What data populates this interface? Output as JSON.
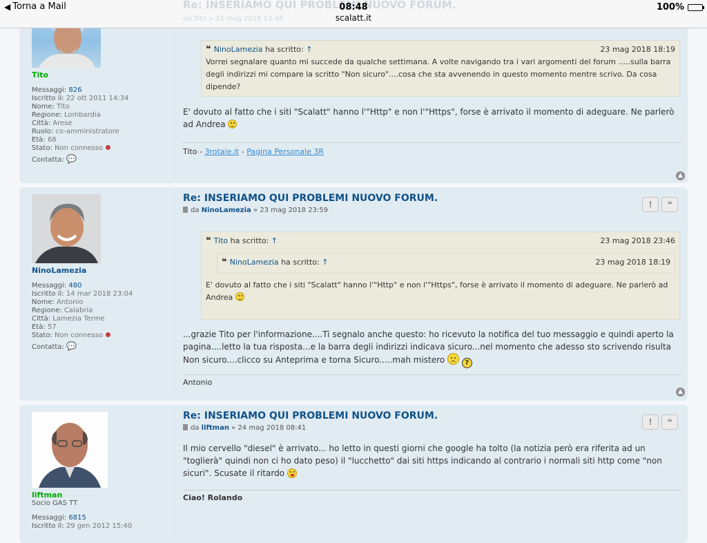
{
  "status_bar": {
    "back_label": "Torna a Mail",
    "time": "08:48",
    "url": "scalatt.it",
    "battery": "100%"
  },
  "ghost": {
    "title": "Re: INSERIAMO QUI PROBLEMI NUOVO FORUM.",
    "meta": "da Tito » 23 mag 2018 23:46"
  },
  "posts": [
    {
      "author": "Tito",
      "rows": [
        {
          "k": "Messaggi:",
          "v": "826"
        },
        {
          "k": "Iscritto il:",
          "v": "22 ott 2011 14:34"
        },
        {
          "k": "Nome:",
          "v": "Tito"
        },
        {
          "k": "Regione:",
          "v": "Lombardia"
        },
        {
          "k": "Città:",
          "v": "Arese"
        },
        {
          "k": "Ruolo:",
          "v": "co-amministratore"
        },
        {
          "k": "Età:",
          "v": "68"
        },
        {
          "k": "Stato:",
          "v": "Non connesso"
        }
      ],
      "contact": "Contatta:",
      "quote": {
        "author": "NinoLamezia",
        "wrote": "ha scritto:",
        "arrow": "↑",
        "date": "23 mag 2018 18:19",
        "text": "Vorrei segnalare quanto mi succede da qualche settimana. A volte navigando tra i vari argomenti del forum .....sulla barra degli indirizzi mi compare la scritto \"Non sicuro\"....cosa che sta avvenendo in questo momento mentre scrivo. Da cosa dipende?"
      },
      "text": "E' dovuto al fatto che i siti \"Scalatt\" hanno l'\"Http\" e non l'\"Https\", forse è arrivato il momento di adeguare. Ne parlerò ad Andrea",
      "sig_prefix": "Tito - ",
      "sig_link1": "3rotaie.it",
      "sig_sep": " - ",
      "sig_link2": "Pagina Personale 3R"
    },
    {
      "author": "NinoLamezia",
      "title": "Re: INSERIAMO QUI PROBLEMI NUOVO FORUM.",
      "meta_da": "da",
      "meta_author": "NinoLamezia",
      "meta_date": "» 23 mag 2018 23:59",
      "rows": [
        {
          "k": "Messaggi:",
          "v": "480"
        },
        {
          "k": "Iscritto il:",
          "v": "14 mar 2018 23:04"
        },
        {
          "k": "Nome:",
          "v": "Antonio"
        },
        {
          "k": "Regione:",
          "v": "Calabria"
        },
        {
          "k": "Città:",
          "v": "Lamezia Terme"
        },
        {
          "k": "Età:",
          "v": "57"
        },
        {
          "k": "Stato:",
          "v": "Non connesso"
        }
      ],
      "contact": "Contatta:",
      "quote": {
        "author": "Tito",
        "wrote": "ha scritto:",
        "arrow": "↑",
        "date": "23 mag 2018 23:46",
        "inner": {
          "author": "NinoLamezia",
          "wrote": "ha scritto:",
          "arrow": "↑",
          "date": "23 mag 2018 18:19"
        },
        "text": "E' dovuto al fatto che i siti \"Scalatt\" hanno l'\"Http\" e non l'\"Https\", forse è arrivato il momento di adeguare. Ne parlerò ad Andrea"
      },
      "text": "...grazie Tito per l'informazione....Ti segnalo anche questo: ho ricevuto la notifica del tuo messaggio e quindi aperto la pagina....letto la tua risposta...e la barra degli indirizzi indicava sicuro...nel momento che adesso sto scrivendo risulta Non sicuro....clicco su Anteprima e torna Sicuro.....mah mistero",
      "sig": "Antonio"
    },
    {
      "author": "liftman",
      "rank": "Socio GAS TT",
      "title": "Re: INSERIAMO QUI PROBLEMI NUOVO FORUM.",
      "meta_da": "da",
      "meta_author": "liftman",
      "meta_date": "» 24 mag 2018 08:41",
      "rows": [
        {
          "k": "Messaggi:",
          "v": "6815"
        },
        {
          "k": "Iscritto il:",
          "v": "29 gen 2012 15:40"
        }
      ],
      "text": "Il mio cervello \"diesel\" è arrivato... ho letto in questi giorni che google ha tolto (la notizia però era riferita ad un \"toglierà\" quindi non ci ho dato peso) il \"lucchetto\" dai siti https indicando al contrario i normali siti http come \"non sicuri\". Scusate il ritardo",
      "sig": "Ciao! Rolando"
    }
  ],
  "buttons": {
    "report": "!",
    "quote": "❝"
  },
  "colors": {
    "link": "#105289",
    "green_user": "#00aa00",
    "post_bg": "#e1ebf2",
    "quote_bg": "#ebeadd",
    "offline_dot": "#c53c3c"
  }
}
